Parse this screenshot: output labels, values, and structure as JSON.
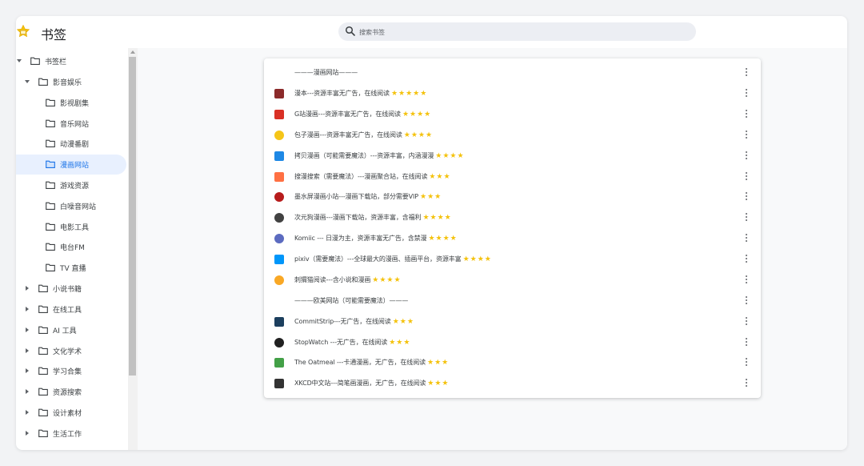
{
  "app": {
    "title": "书签",
    "icon": "star-folder-icon"
  },
  "search": {
    "placeholder": "搜索书签"
  },
  "sidebar": {
    "items": [
      {
        "label": "书签栏",
        "level": 0,
        "expanded": true
      },
      {
        "label": "影音娱乐",
        "level": 1,
        "expanded": true
      },
      {
        "label": "影视剧集",
        "level": 2
      },
      {
        "label": "音乐网站",
        "level": 2
      },
      {
        "label": "动漫番剧",
        "level": 2
      },
      {
        "label": "漫画网站",
        "level": 2,
        "selected": true
      },
      {
        "label": "游戏资源",
        "level": 2
      },
      {
        "label": "白噪音网站",
        "level": 2
      },
      {
        "label": "电影工具",
        "level": 2
      },
      {
        "label": "电台FM",
        "level": 2
      },
      {
        "label": "TV 直播",
        "level": 2
      },
      {
        "label": "小说书籍",
        "level": 1,
        "expanded": false
      },
      {
        "label": "在线工具",
        "level": 1,
        "expanded": false
      },
      {
        "label": "AI 工具",
        "level": 1,
        "expanded": false
      },
      {
        "label": "文化学术",
        "level": 1,
        "expanded": false
      },
      {
        "label": "学习合集",
        "level": 1,
        "expanded": false
      },
      {
        "label": "资源搜索",
        "level": 1,
        "expanded": false
      },
      {
        "label": "设计素材",
        "level": 1,
        "expanded": false
      },
      {
        "label": "生活工作",
        "level": 1,
        "expanded": false
      }
    ]
  },
  "bookmarks": [
    {
      "title": "———漫画网站———",
      "separator": true
    },
    {
      "title": "漫本---资源丰富无广告，在线阅读",
      "stars": "★★★★★",
      "icon": "manben-icon",
      "color": "#8b2a2a"
    },
    {
      "title": "G站漫画---资源丰富无广告，在线阅读",
      "stars": "★★★★",
      "icon": "g-manhua-icon",
      "color": "#d93025"
    },
    {
      "title": "包子漫画---资源丰富无广告，在线阅读",
      "stars": "★★★★",
      "icon": "baozi-icon",
      "color": "#f5c518"
    },
    {
      "title": "拷贝漫画（可能需要魔法）---资源丰富，内涵漫漫",
      "stars": "★★★★",
      "icon": "copy-manga-icon",
      "color": "#1e88e5"
    },
    {
      "title": "搜漫搜索（需要魔法）---漫画聚合站，在线阅读",
      "stars": "★★★",
      "icon": "soman-icon",
      "color": "#ff7043"
    },
    {
      "title": "墨水屏漫画小站---漫画下载站，部分需要VIP",
      "stars": "★★★",
      "icon": "eink-icon",
      "color": "#b71c1c"
    },
    {
      "title": "次元狗漫画---漫画下载站，资源丰富，含福利",
      "stars": "★★★★",
      "icon": "ciyuangou-icon",
      "color": "#424242"
    },
    {
      "title": "Komiic --- 日漫为主，资源丰富无广告，含禁漫",
      "stars": "★★★★",
      "icon": "komiic-icon",
      "color": "#5c6bc0"
    },
    {
      "title": "pixiv（需要魔法）---全球最大的漫画、插画平台，资源丰富",
      "stars": "★★★★",
      "icon": "pixiv-icon",
      "color": "#0096fa"
    },
    {
      "title": "刺猬猫阅读---含小说和漫画",
      "stars": "★★★★",
      "icon": "ciweimao-icon",
      "color": "#f9a825"
    },
    {
      "title": "———欧美网站（可能需要魔法）———",
      "separator": true
    },
    {
      "title": "CommitStrip---无广告，在线阅读",
      "stars": "★★★",
      "icon": "commitstrip-icon",
      "color": "#1c3f5e"
    },
    {
      "title": "StopWatch ---无广告，在线阅读",
      "stars": "★★★",
      "icon": "stopwatch-icon",
      "color": "#212121"
    },
    {
      "title": "The Oatmeal ---卡通漫画，无广告，在线阅读",
      "stars": "★★★",
      "icon": "oatmeal-icon",
      "color": "#43a047"
    },
    {
      "title": "XKCD中文站---简笔画漫画，无广告，在线阅读",
      "stars": "★★★",
      "icon": "xkcd-icon",
      "color": "#333333"
    }
  ]
}
